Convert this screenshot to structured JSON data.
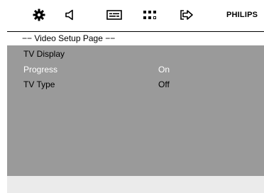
{
  "toolbar": {
    "icons": [
      "gear-icon",
      "speaker-icon",
      "subtitle-icon",
      "preference-icon",
      "exit-icon"
    ],
    "brand": "PHILIPS"
  },
  "header": {
    "title": "−− Video Setup Page −−"
  },
  "menu": {
    "items": [
      {
        "label": "TV Display",
        "value": "",
        "highlighted": false
      },
      {
        "label": "Progress",
        "value": "On",
        "highlighted": true
      },
      {
        "label": "TV Type",
        "value": "Off",
        "highlighted": false
      }
    ]
  },
  "colors": {
    "panel": "#9a9a9a",
    "highlight_text": "#ffffff",
    "footer": "#ebebeb"
  }
}
